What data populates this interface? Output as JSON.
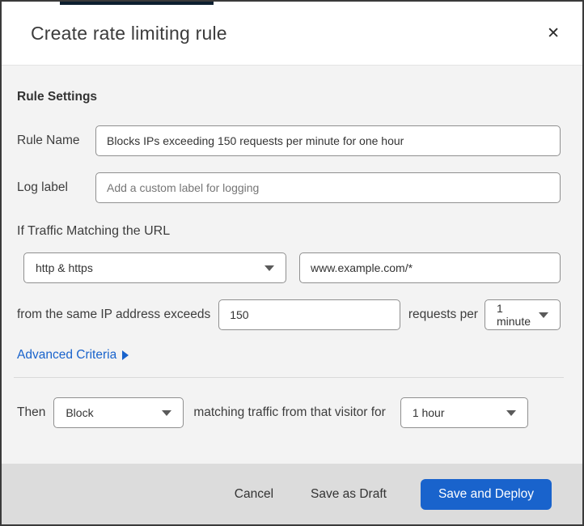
{
  "modal": {
    "title": "Create rate limiting rule",
    "close_glyph": "✕"
  },
  "body": {
    "section_heading": "Rule Settings",
    "rule_name": {
      "label": "Rule Name",
      "value": "Blocks IPs exceeding 150 requests per minute for one hour"
    },
    "log_label": {
      "label": "Log label",
      "placeholder": "Add a custom label for logging"
    },
    "traffic": {
      "heading": "If Traffic Matching the URL",
      "scheme_select": {
        "value": "http & https"
      },
      "url_input": {
        "value": "www.example.com/*"
      },
      "threshold_prefix": "from the same IP address exceeds",
      "threshold_value": "150",
      "threshold_suffix": "requests per",
      "period_select": {
        "value": "1 minute"
      },
      "advanced_link": "Advanced Criteria"
    },
    "then": {
      "prefix": "Then",
      "action_select": {
        "value": "Block"
      },
      "middle": "matching traffic from that visitor for",
      "duration_select": {
        "value": "1 hour"
      }
    }
  },
  "footer": {
    "cancel": "Cancel",
    "save_draft": "Save as Draft",
    "save_deploy": "Save and Deploy"
  },
  "colors": {
    "accent_blue": "#1963cc",
    "link_blue": "#1963cc",
    "footer_gray": "#dcdcdc",
    "body_gray": "#f3f3f3",
    "top_strip_navy": "#0d2030"
  }
}
